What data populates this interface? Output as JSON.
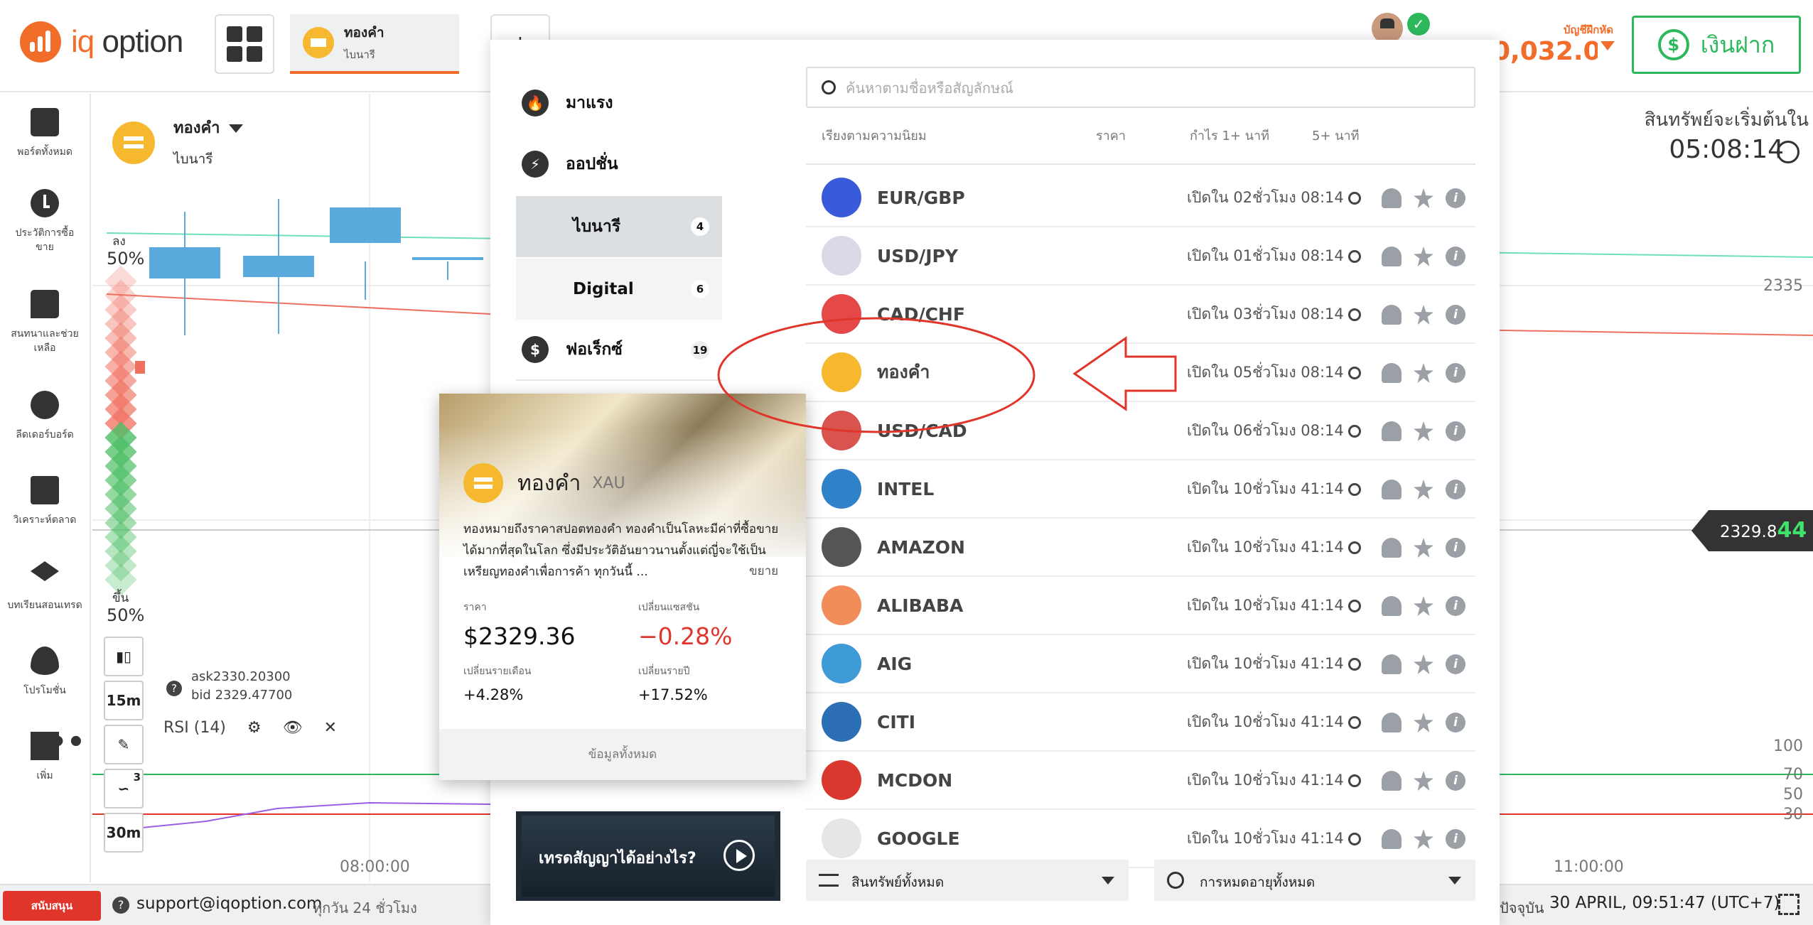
{
  "header": {
    "logo_text_a": "iq",
    "logo_text_b": " option",
    "tab": {
      "name": "ทองคำ",
      "type": "ไบนารี"
    },
    "add_tab": "+",
    "balance_label": "บัญชีฝึกหัด",
    "balance_value": "0,032.01",
    "deposit_label": "เงินฝาก",
    "deposit_icon": "$",
    "avatar_ok": "✓"
  },
  "sidebar": {
    "items": [
      {
        "label": "พอร์ตทั้งหมด",
        "icon": "portfolio-icon"
      },
      {
        "label": "ประวัติการซื้อขาย",
        "icon": "history-icon"
      },
      {
        "label": "สนทนาและช่วยเหลือ",
        "icon": "chat-icon"
      },
      {
        "label": "ลีดเดอร์บอร์ด",
        "icon": "leaderboard-icon"
      },
      {
        "label": "วิเคราะห์ตลาด",
        "icon": "analysis-icon"
      },
      {
        "label": "บทเรียนสอนเทรด",
        "icon": "education-icon"
      },
      {
        "label": "โปรโมชั่น",
        "icon": "promotion-icon"
      },
      {
        "label": "เพิ่ม",
        "icon": "more-icon"
      }
    ],
    "more_glyph": "•••"
  },
  "chart": {
    "asset_name": "ทองคำ",
    "asset_type": "ไบนารี",
    "sentiment_down_label": "ลง",
    "sentiment_down": "50%",
    "sentiment_up_label": "ขึ้น",
    "sentiment_up": "50%",
    "tools": {
      "candle": "▮▯",
      "interval1": "15m",
      "draw": "✎",
      "indicator": "∽",
      "indicator_count": "3",
      "interval2": "30m"
    },
    "ask": "ask2330.20300",
    "bid": "bid 2329.47700",
    "help": "?",
    "rsi_label": "RSI (14)",
    "rsi_icons": {
      "settings": "⚙",
      "eye": "👁",
      "close": "✕"
    },
    "countdown_label": "สินทรัพย์จะเริ่มต้นใน",
    "countdown": "05:08:14",
    "price_main": "2329.8",
    "price_tail": "44",
    "y_ticks": [
      "2335",
      "100",
      "70",
      "50",
      "30"
    ],
    "x_ticks": [
      "08:00:00",
      "11:00:00"
    ],
    "colors": {
      "up": "#5aaadd",
      "down": "#f07060",
      "rsi": "#9b5de5",
      "rsi_70": "#2eb85c",
      "rsi_30": "#e0352b"
    }
  },
  "bottom": {
    "support_btn": "สนับสนุน",
    "help": "?",
    "email": "support@iqoption.com",
    "hours": "ทุกวัน 24 ชั่วโมง",
    "time_label": "ปัจจุบัน",
    "time": "30 APRIL, 09:51:47 (UTC+7)"
  },
  "picker": {
    "categories": [
      {
        "label": "มาแรง",
        "icon": "fire-icon",
        "glyph": "🔥"
      },
      {
        "label": "ออปชั่น",
        "icon": "lightning-icon",
        "glyph": "⚡"
      }
    ],
    "subcategories": [
      {
        "label": "ไบนารี",
        "count": "4",
        "active": true
      },
      {
        "label": "Digital",
        "count": "6",
        "active": false
      }
    ],
    "forex": {
      "label": "ฟอเร็กซ์",
      "count": "19",
      "glyph": "$"
    },
    "search_placeholder": "ค้นหาตามชื่อหรือสัญลักษณ์",
    "columns": {
      "sort": "เรียงตามความนิยม",
      "price": "ราคา",
      "profit": "กำไร 1+ นาที",
      "profit5": "5+ นาที"
    },
    "assets": [
      {
        "name": "EUR/GBP",
        "opens": "เปิดใน 02ชั่วโมง 08:14",
        "color": "#3a5bd9"
      },
      {
        "name": "USD/JPY",
        "opens": "เปิดใน 01ชั่วโมง 08:14",
        "color": "#d9d9e8"
      },
      {
        "name": "CAD/CHF",
        "opens": "เปิดใน 03ชั่วโมง 08:14",
        "color": "#e54848"
      },
      {
        "name": "ทองคำ",
        "opens": "เปิดใน 05ชั่วโมง 08:14",
        "color": "#f5b82e"
      },
      {
        "name": "USD/CAD",
        "opens": "เปิดใน 06ชั่วโมง 08:14",
        "color": "#d9534f"
      },
      {
        "name": "INTEL",
        "opens": "เปิดใน 10ชั่วโมง 41:14",
        "color": "#2e82c8"
      },
      {
        "name": "AMAZON",
        "opens": "เปิดใน 10ชั่วโมง 41:14",
        "color": "#555555"
      },
      {
        "name": "ALIBABA",
        "opens": "เปิดใน 10ชั่วโมง 41:14",
        "color": "#f28d5a"
      },
      {
        "name": "AIG",
        "opens": "เปิดใน 10ชั่วโมง 41:14",
        "color": "#3e9bd6"
      },
      {
        "name": "CITI",
        "opens": "เปิดใน 10ชั่วโมง 41:14",
        "color": "#2d6fb6"
      },
      {
        "name": "MCDON",
        "opens": "เปิดใน 10ชั่วโมง 41:14",
        "color": "#d9382e"
      },
      {
        "name": "GOOGLE",
        "opens": "เปิดใน 10ชั่วโมง 41:14",
        "color": "#e6e6e6"
      }
    ],
    "info_glyph": "i",
    "filter_assets": "สินทรัพย์ทั้งหมด",
    "filter_expiry": "การหมดอายุทั้งหมด"
  },
  "video": {
    "label": "เทรดสัญญาได้อย่างไร?"
  },
  "card": {
    "name": "ทองคำ",
    "symbol": "XAU",
    "description": "ทองหมายถึงราคาสปอตทองคำ ทองคำเป็นโลหะมีค่าที่ซื้อขายได้มากที่สุดในโลก ซึ่งมีประวัติอันยาวนานตั้งแต่ญี่จะใช้เป็นเหรียญทองคำเพื่อการค้า ทุกวันนี้ ...",
    "more": "ขยาย",
    "price_label": "ราคา",
    "price": "$2329.36",
    "session_label": "เปลี่ยนแซสชัน",
    "session": "−0.28%",
    "month_label": "เปลี่ยนรายเดือน",
    "month": "+4.28%",
    "year_label": "เปลี่ยนรายปี",
    "year": "+17.52%",
    "footer": "ข้อมูลทั้งหมด"
  }
}
